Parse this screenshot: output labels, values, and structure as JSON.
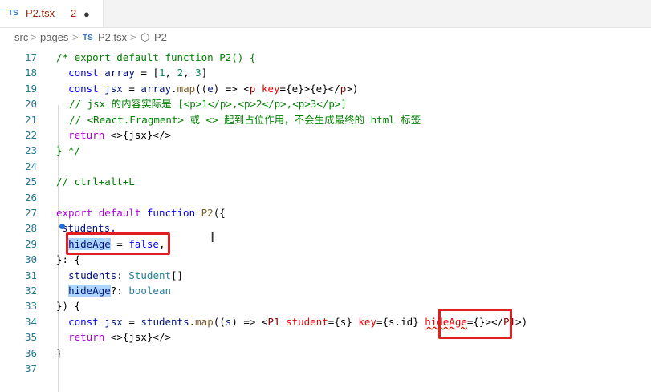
{
  "tab": {
    "lang": "TS",
    "filename": "P2.tsx",
    "problems": "2",
    "modified_dot": "●"
  },
  "breadcrumb": {
    "src": "src",
    "pages": "pages",
    "file_lang": "TS",
    "file": "P2.tsx",
    "symbol": "P2",
    "sep": ">"
  },
  "lines": [
    {
      "n": "17",
      "text": "/* export default function P2() {"
    },
    {
      "n": "18",
      "text": "  const array = [1, 2, 3]"
    },
    {
      "n": "19",
      "text": "  const jsx = array.map((e) => <p key={e}>{e}</p>)"
    },
    {
      "n": "20",
      "text": "  // jsx 的内容实际是 [<p>1</p>,<p>2</p>,<p>3</p>]"
    },
    {
      "n": "21",
      "text": "  // <React.Fragment> 或 <> 起到占位作用，不会生成最终的 html 标签"
    },
    {
      "n": "22",
      "text": "  return <>{jsx}</>"
    },
    {
      "n": "23",
      "text": "} */"
    },
    {
      "n": "24",
      "text": ""
    },
    {
      "n": "25",
      "text": "// ctrl+alt+L"
    },
    {
      "n": "26",
      "text": ""
    },
    {
      "n": "27",
      "text": "export default function P2({"
    },
    {
      "n": "28",
      "text": "  students,"
    },
    {
      "n": "29",
      "text": "  hideAge = false,"
    },
    {
      "n": "30",
      "text": "}: {"
    },
    {
      "n": "31",
      "text": "  students: Student[]"
    },
    {
      "n": "32",
      "text": "  hideAge?: boolean"
    },
    {
      "n": "33",
      "text": "}) {"
    },
    {
      "n": "34",
      "text": "  const jsx = students.map((s) => <P1 student={s} key={s.id} hideAge={}></P1>)"
    },
    {
      "n": "35",
      "text": "  return <>{jsx}</>"
    },
    {
      "n": "36",
      "text": "}"
    },
    {
      "n": "37",
      "text": ""
    }
  ],
  "colors": {
    "comment": "#008000",
    "keyword": "#0000ff",
    "control": "#af00db",
    "function": "#795e26",
    "variable": "#001080",
    "number": "#098658",
    "tag": "#800000",
    "attribute": "#e50000",
    "type": "#267f99",
    "selection": "#add6ff",
    "highlight_box": "#e02020",
    "line_number": "#237893"
  },
  "tokens": {
    "l17": "/* export default function P2() {",
    "l18_kw": "const",
    "l18_var": "array",
    "l18_eq": " = [",
    "l18_1": "1",
    "l18_c1": ", ",
    "l18_2": "2",
    "l18_c2": ", ",
    "l18_3": "3",
    "l18_end": "]",
    "l19_kw": "const",
    "l19_var": "jsx",
    "l19_eq": " = ",
    "l19_arr": "array",
    "l19_dot": ".",
    "l19_map": "map",
    "l19_p1": "((",
    "l19_e": "e",
    "l19_arrow": ") => <",
    "l19_p": "p",
    "l19_key": "key",
    "l19_rest": "={e}>{e}</",
    "l19_p2": "p",
    "l19_end": ">)",
    "l20": "// jsx 的内容实际是 [<p>1</p>,<p>2</p>,<p>3</p>]",
    "l21": "// <React.Fragment> 或 <> 起到占位作用，不会生成最终的 html 标签",
    "l22_ret": "return",
    "l22_rest": " <>{jsx}</>",
    "l23": "} */",
    "l25": "// ctrl+alt+L",
    "l27_export": "export",
    "l27_default": "default",
    "l27_function": "function",
    "l27_name": "P2",
    "l27_end": "({",
    "l28": "students,",
    "l29_sel": "hideAge",
    "l29_eq": " = ",
    "l29_false": "false",
    "l29_end": ",",
    "l30": "}: {",
    "l31_name": "students",
    "l31_colon": ": ",
    "l31_type": "Student",
    "l31_end": "[]",
    "l32_name": "hideAge",
    "l32_colon": "?: ",
    "l32_type": "boolean",
    "l33": "}) {",
    "l34_kw": "const",
    "l34_var": "jsx",
    "l34_eq": " = ",
    "l34_st": "students",
    "l34_dot": ".",
    "l34_map": "map",
    "l34_p1": "((",
    "l34_s": "s",
    "l34_arrow": ") => <",
    "l34_P1": "P1",
    "l34_student": "student",
    "l34_v1": "={s} ",
    "l34_key": "key",
    "l34_v2": "={s.id} ",
    "l34_hide": "hideAge",
    "l34_v3": "={}></",
    "l34_P1b": "P1",
    "l34_end": ">)",
    "l35_ret": "return",
    "l35_rest": " <>{jsx}</>",
    "l36": "}"
  }
}
